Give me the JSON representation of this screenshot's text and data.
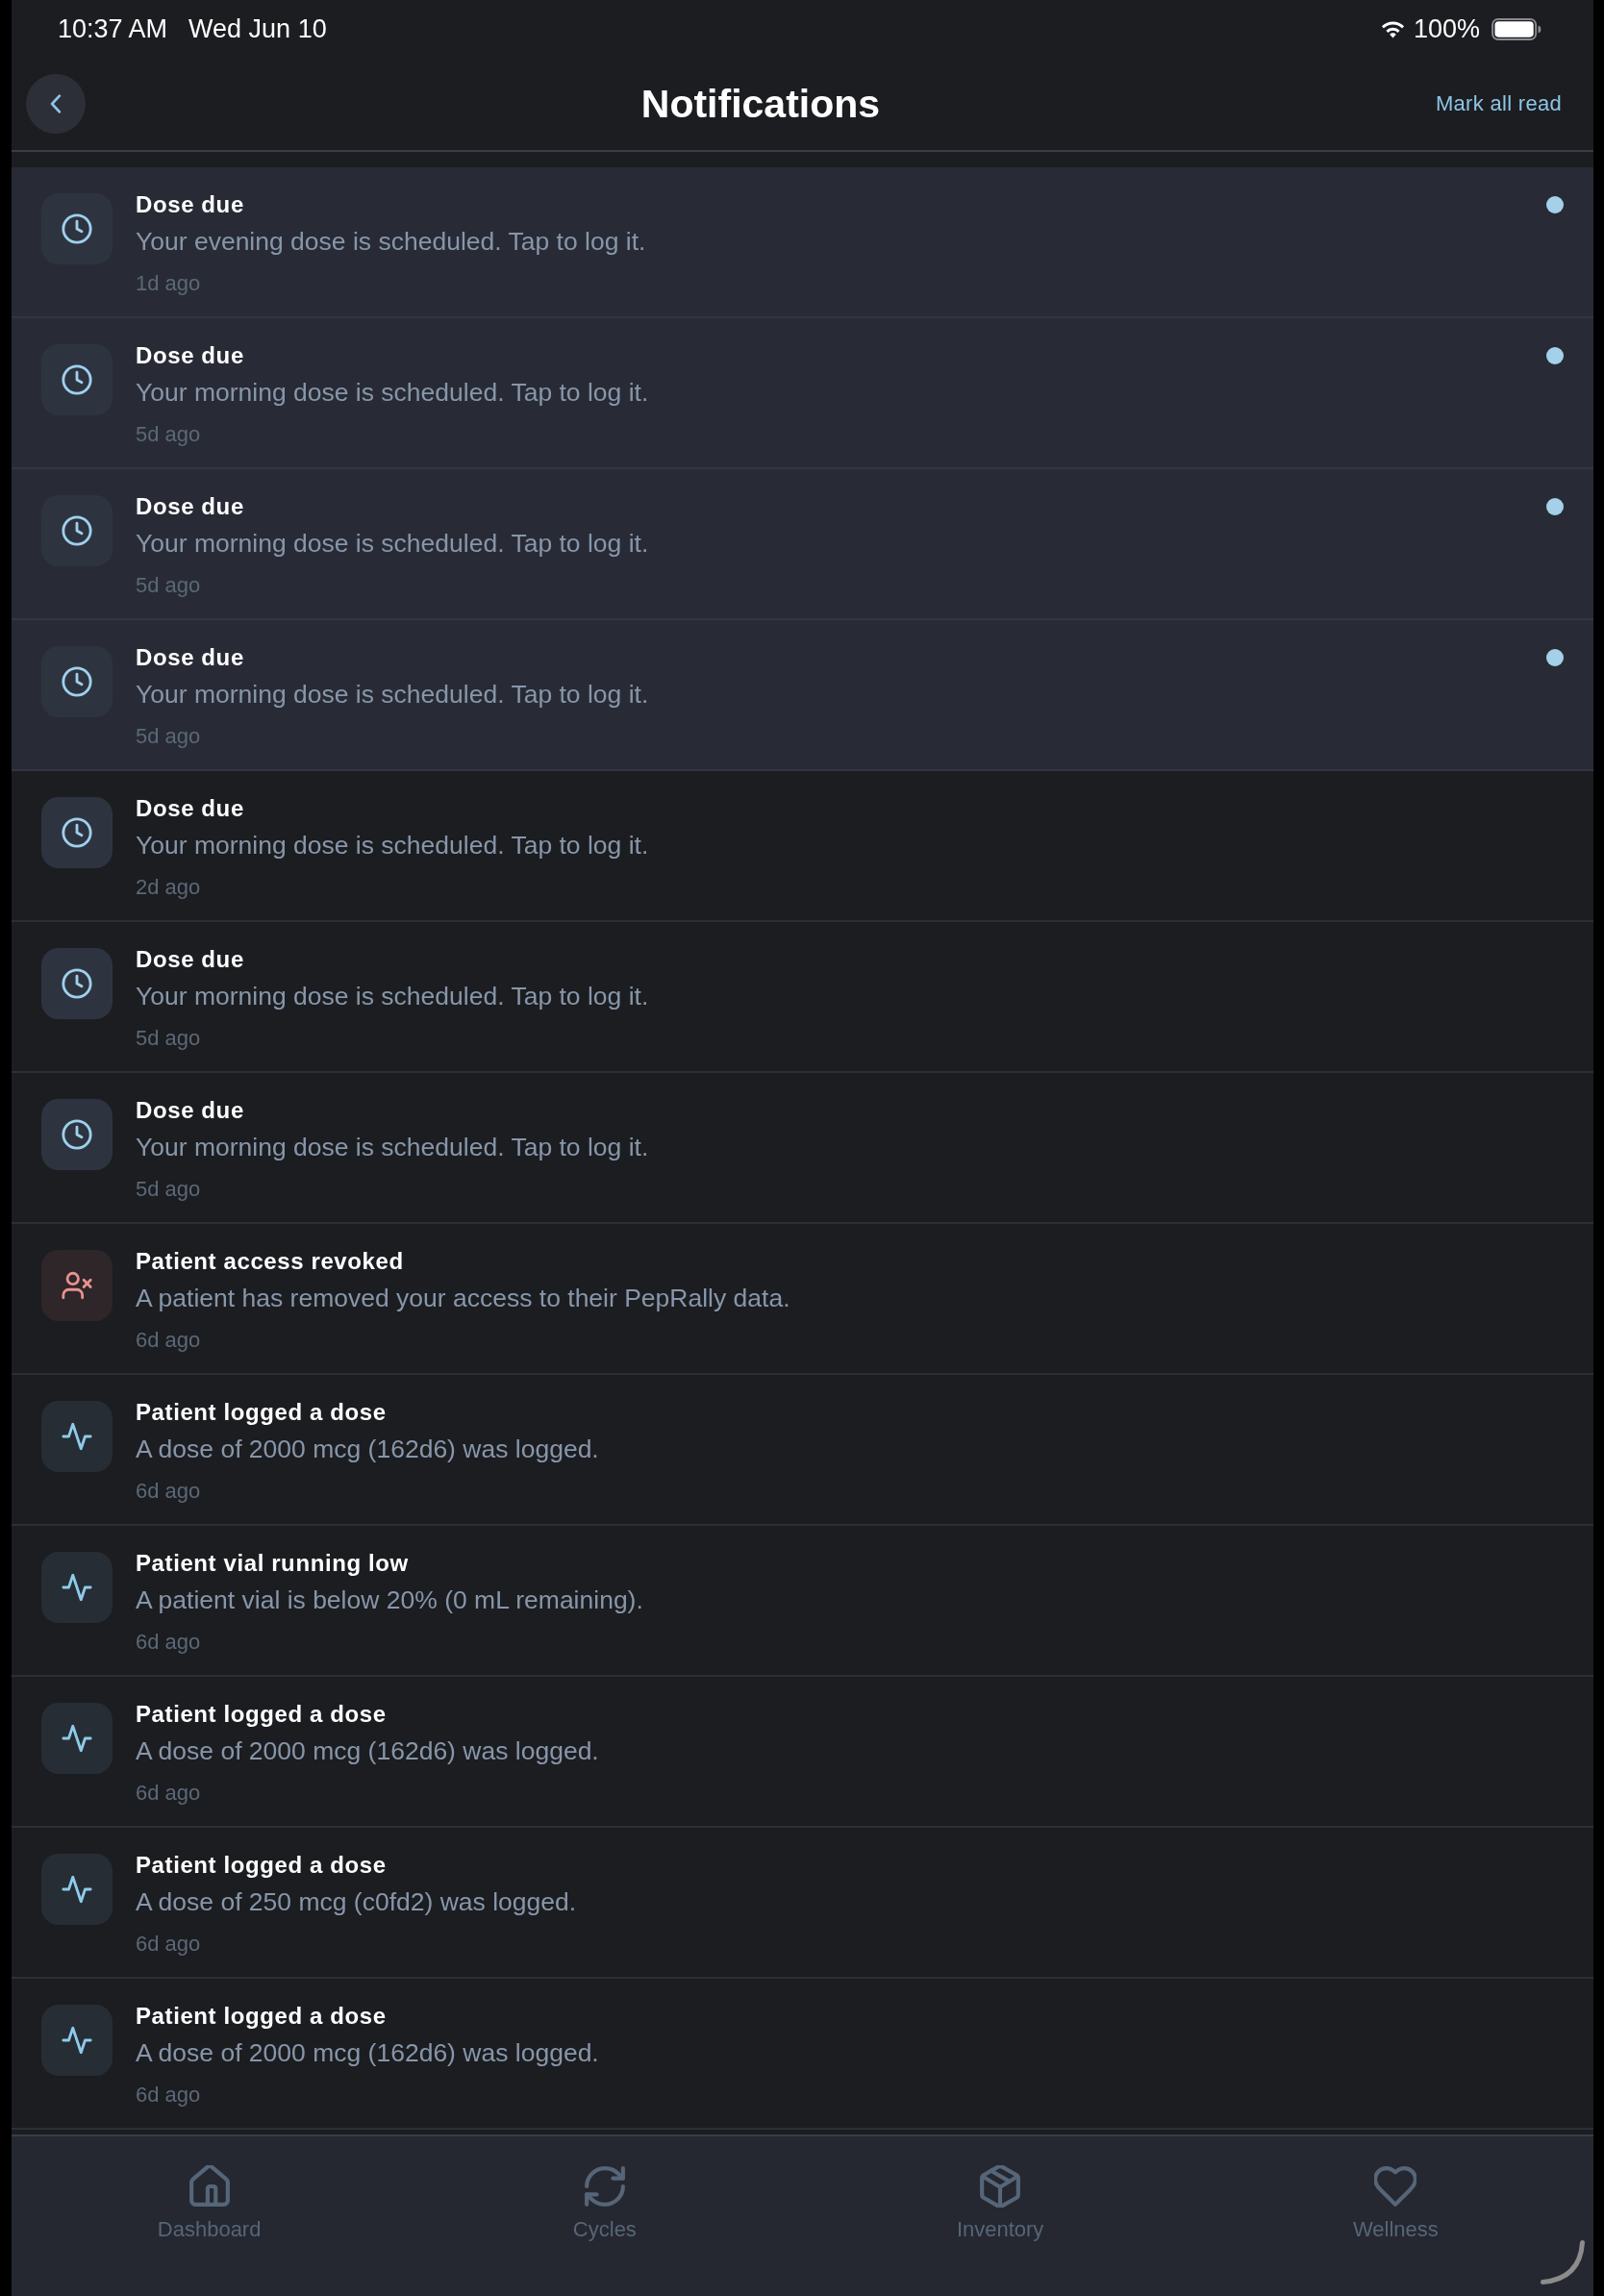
{
  "status_bar": {
    "time": "10:37 AM",
    "date": "Wed Jun 10",
    "battery": "100%"
  },
  "header": {
    "title": "Notifications",
    "action": "Mark all read"
  },
  "notifications": [
    {
      "kind": "dose",
      "title": "Dose due",
      "message": "Your evening dose is scheduled. Tap to log it.",
      "time": "1d ago",
      "unread": true
    },
    {
      "kind": "dose",
      "title": "Dose due",
      "message": "Your morning dose is scheduled. Tap to log it.",
      "time": "5d ago",
      "unread": true
    },
    {
      "kind": "dose",
      "title": "Dose due",
      "message": "Your morning dose is scheduled. Tap to log it.",
      "time": "5d ago",
      "unread": true
    },
    {
      "kind": "dose",
      "title": "Dose due",
      "message": "Your morning dose is scheduled. Tap to log it.",
      "time": "5d ago",
      "unread": true
    },
    {
      "kind": "dose",
      "title": "Dose due",
      "message": "Your morning dose is scheduled. Tap to log it.",
      "time": "2d ago",
      "unread": false
    },
    {
      "kind": "dose",
      "title": "Dose due",
      "message": "Your morning dose is scheduled. Tap to log it.",
      "time": "5d ago",
      "unread": false
    },
    {
      "kind": "dose",
      "title": "Dose due",
      "message": "Your morning dose is scheduled. Tap to log it.",
      "time": "5d ago",
      "unread": false
    },
    {
      "kind": "revoked",
      "title": "Patient access revoked",
      "message": "A patient has removed your access to their PepRally data.",
      "time": "6d ago",
      "unread": false
    },
    {
      "kind": "activity",
      "title": "Patient logged a dose",
      "message": "A dose of 2000 mcg (162d6) was logged.",
      "time": "6d ago",
      "unread": false
    },
    {
      "kind": "activity",
      "title": "Patient vial running low",
      "message": "A patient vial is below 20% (0 mL remaining).",
      "time": "6d ago",
      "unread": false
    },
    {
      "kind": "activity",
      "title": "Patient logged a dose",
      "message": "A dose of 2000 mcg (162d6) was logged.",
      "time": "6d ago",
      "unread": false
    },
    {
      "kind": "activity",
      "title": "Patient logged a dose",
      "message": "A dose of 250 mcg (c0fd2) was logged.",
      "time": "6d ago",
      "unread": false
    },
    {
      "kind": "activity",
      "title": "Patient logged a dose",
      "message": "A dose of 2000 mcg (162d6) was logged.",
      "time": "6d ago",
      "unread": false
    }
  ],
  "tab_bar": [
    {
      "label": "Dashboard",
      "selected": false
    },
    {
      "label": "Cycles",
      "selected": false
    },
    {
      "label": "Inventory",
      "selected": false
    },
    {
      "label": "Wellness",
      "selected": false
    }
  ]
}
